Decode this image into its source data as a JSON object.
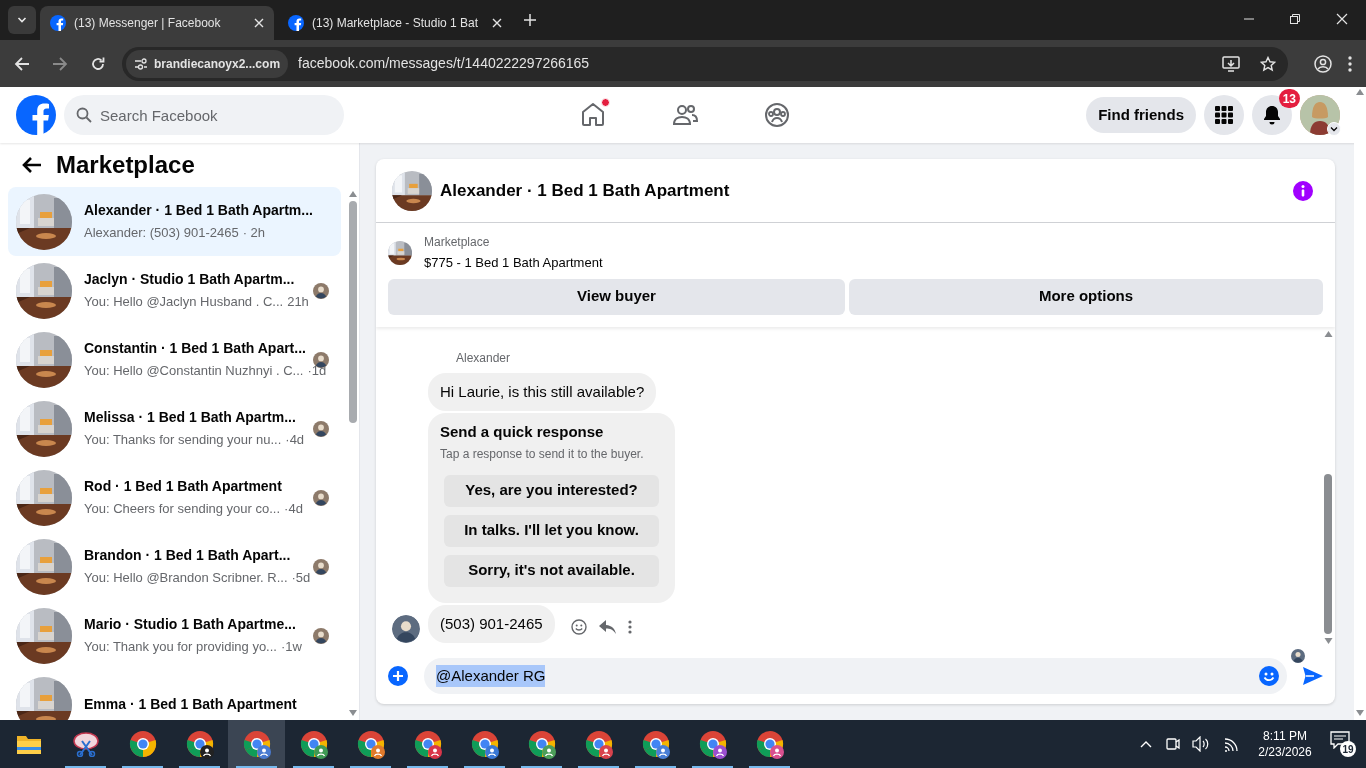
{
  "browser": {
    "tabs": [
      {
        "title": "(13) Messenger | Facebook",
        "selected": true
      },
      {
        "title": "(13) Marketplace - Studio 1 Bat",
        "selected": false
      }
    ],
    "site_chip": "brandiecanoyx2...com",
    "url": "facebook.com/messages/t/1440222297266165"
  },
  "header": {
    "search": {
      "placeholder": "Search Facebook"
    },
    "nav": [
      {
        "kind": "home",
        "unread": true
      },
      {
        "kind": "friends",
        "unread": false
      },
      {
        "kind": "groups",
        "unread": false
      }
    ],
    "find_friends": "Find friends",
    "notifications": "13"
  },
  "sidebar": {
    "title": "Marketplace",
    "conversations": [
      {
        "title": "Alexander · 1 Bed 1 Bath Apartm...",
        "preview": "Alexander: (503) 901-2465",
        "time": "· 2h",
        "selected": true,
        "seen": false
      },
      {
        "title": "Jaclyn · Studio 1 Bath Apartm...",
        "preview": "You: Hello @Jaclyn Husband . C...",
        "time": "21h",
        "selected": false,
        "seen": true
      },
      {
        "title": "Constantin · 1 Bed 1 Bath Apart...",
        "preview": "You: Hello @Constantin Nuzhnyi . C...",
        "time": "·1d",
        "selected": false,
        "seen": true
      },
      {
        "title": "Melissa · 1 Bed 1 Bath Apartm...",
        "preview": "You: Thanks for sending your nu...",
        "time": "·4d",
        "selected": false,
        "seen": true
      },
      {
        "title": "Rod · 1 Bed 1 Bath Apartment",
        "preview": "You: Cheers for sending your co...",
        "time": "·4d",
        "selected": false,
        "seen": true
      },
      {
        "title": "Brandon · 1 Bed 1 Bath Apart...",
        "preview": "You: Hello @Brandon Scribner. R...",
        "time": "·5d",
        "selected": false,
        "seen": true
      },
      {
        "title": "Mario · Studio 1 Bath Apartme...",
        "preview": "You: Thank you for providing yo...",
        "time": "·1w",
        "selected": false,
        "seen": true
      },
      {
        "title": "Emma · 1 Bed 1 Bath Apartment",
        "selected": false,
        "seen": false
      }
    ]
  },
  "chat": {
    "title": "Alexander · 1 Bed 1 Bath Apartment",
    "listing": {
      "label": "Marketplace",
      "name": "$775 - 1 Bed 1 Bath Apartment"
    },
    "actions": [
      "View buyer",
      "More options"
    ],
    "messages": [
      {
        "kind": "sender",
        "text": "Alexander"
      },
      {
        "kind": "bubble",
        "text": "Hi Laurie, is this still available?"
      },
      {
        "kind": "quick",
        "title": "Send a quick response",
        "subtitle": "Tap a response to send it to the buyer.",
        "options": [
          "Yes, are you interested?",
          "In talks. I'll let you know.",
          "Sorry, it's not available."
        ]
      },
      {
        "kind": "bubble",
        "text": "(503) 901-2465",
        "avatar": true
      }
    ],
    "composer": {
      "value": "@Alexander RG",
      "selected": true
    }
  },
  "taskbar": {
    "apps": [
      {
        "kind": "folder",
        "selected": false
      },
      {
        "kind": "snip",
        "selected": false
      },
      {
        "kind": "chrome",
        "selected": false
      },
      {
        "kind": "profile",
        "color": "#222222",
        "selected": false
      },
      {
        "kind": "profile",
        "color": "#4a7bd0",
        "selected": true
      },
      {
        "kind": "profile",
        "color": "#3f9a55",
        "selected": false
      },
      {
        "kind": "profile",
        "color": "#e07a2c",
        "selected": false
      },
      {
        "kind": "profile",
        "color": "#d9364a",
        "selected": false
      },
      {
        "kind": "profile",
        "color": "#3a78d4",
        "selected": false
      },
      {
        "kind": "profile",
        "color": "#4c9f5a",
        "selected": false
      },
      {
        "kind": "profile",
        "color": "#d8434d",
        "selected": false
      },
      {
        "kind": "profile",
        "color": "#4a7fd6",
        "selected": false
      },
      {
        "kind": "profile",
        "color": "#9b4fd0",
        "selected": false
      },
      {
        "kind": "profile",
        "color": "#d8508f",
        "selected": false
      }
    ],
    "time": "8:11 PM",
    "date": "2/23/2026",
    "notifications": "19"
  }
}
